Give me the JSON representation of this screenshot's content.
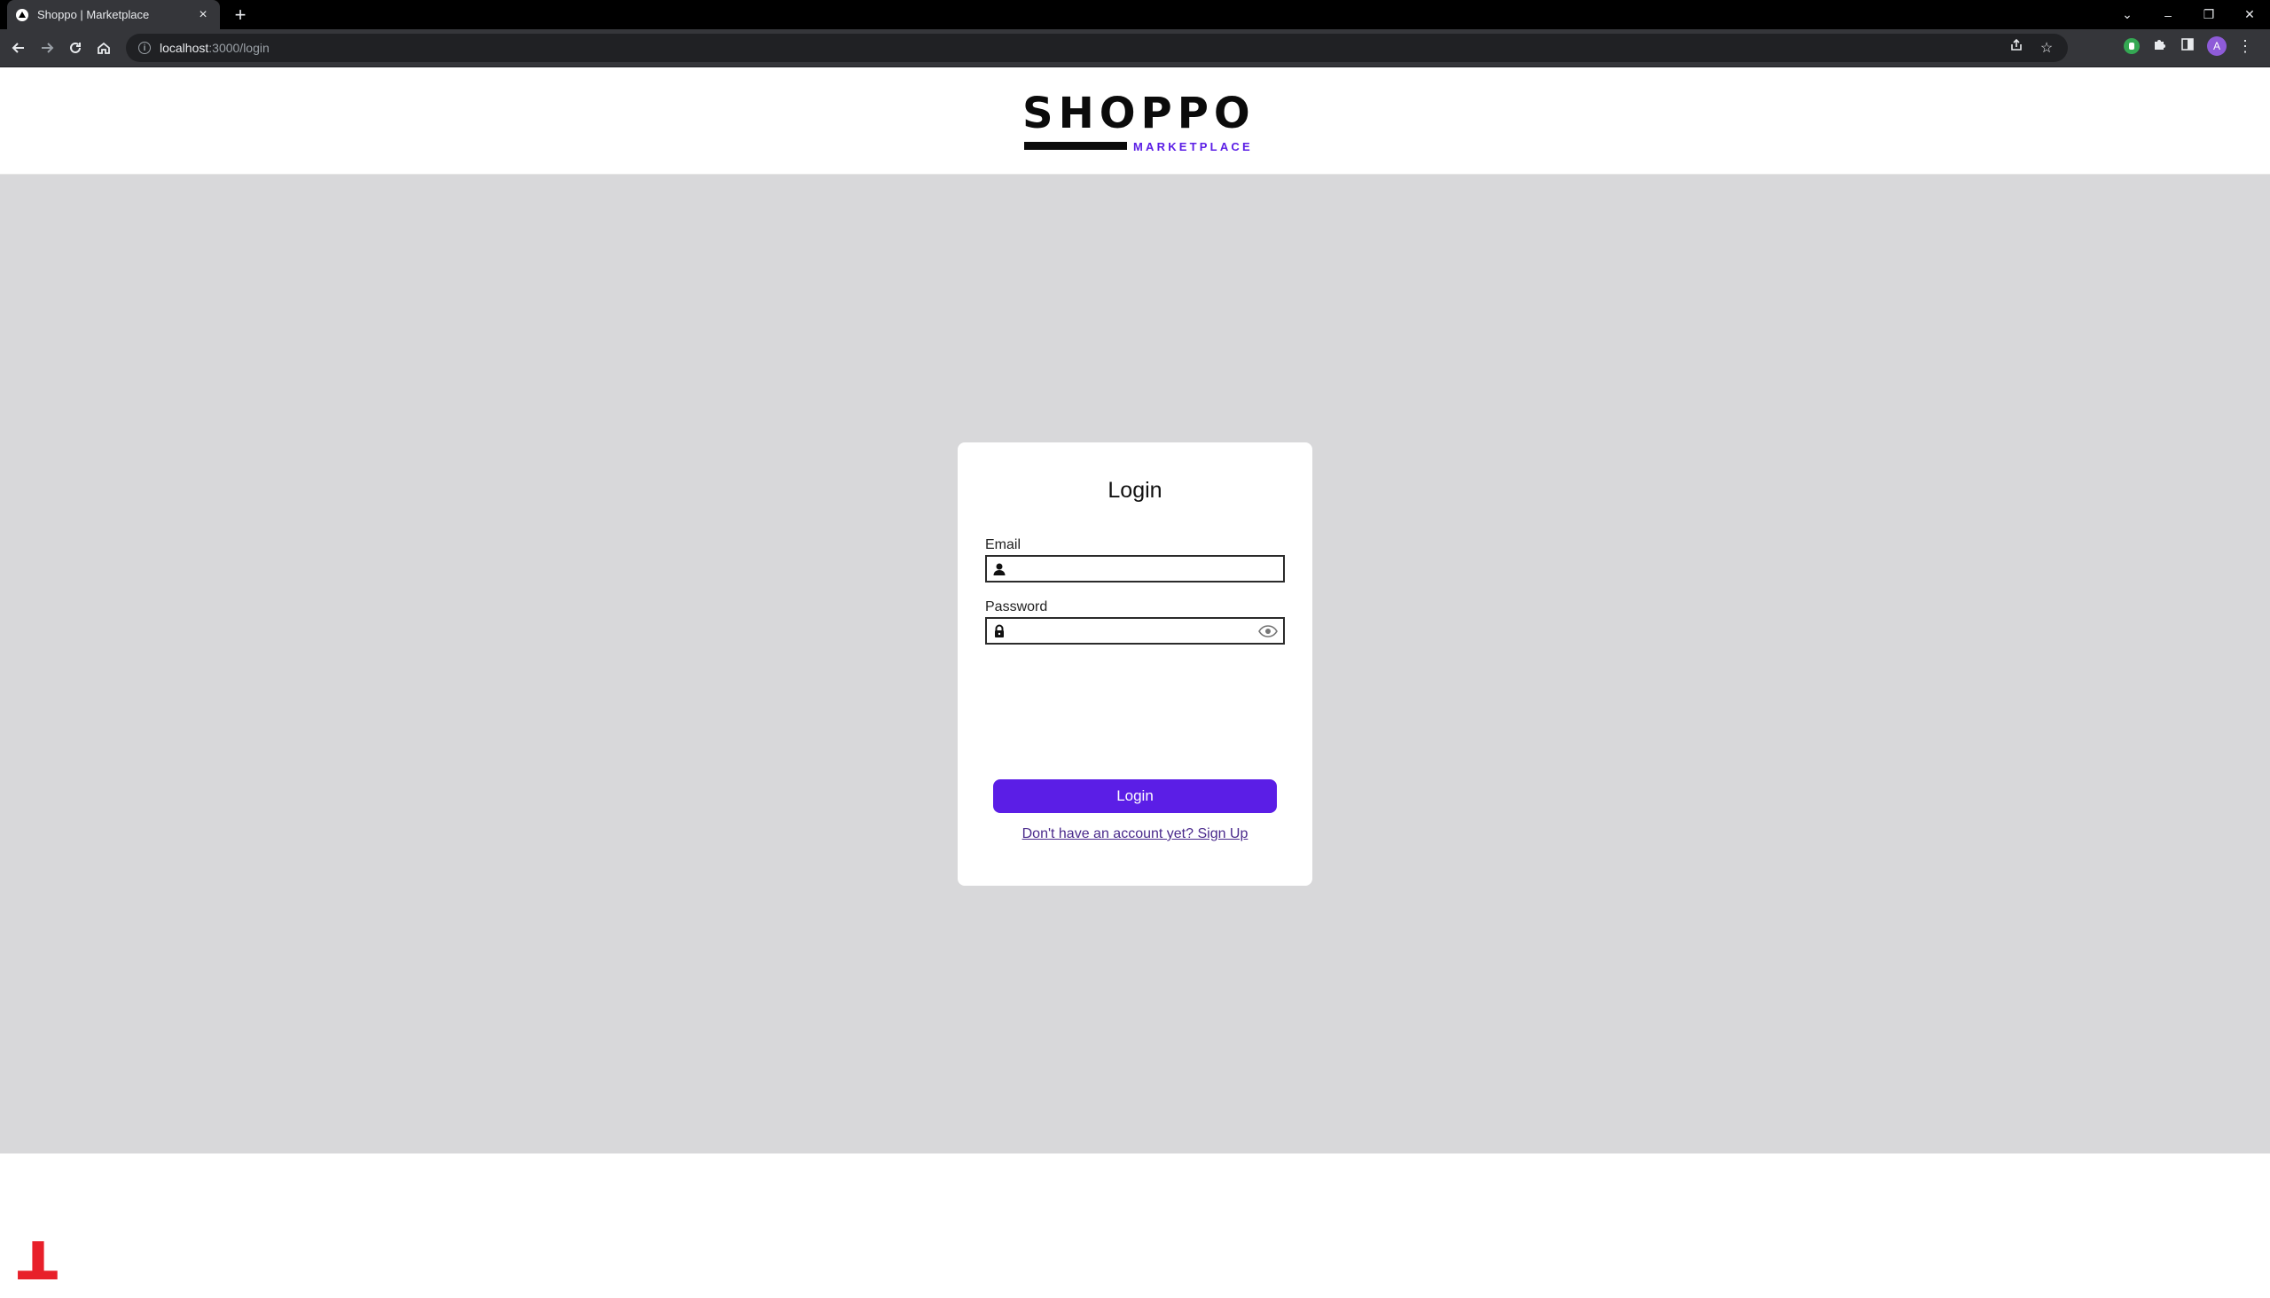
{
  "browser": {
    "tab_title": "Shoppo | Marketplace",
    "tab_close": "×",
    "new_tab": "+",
    "url_host": "localhost",
    "url_path": ":3000/login",
    "window_controls": {
      "minimize": "–",
      "restore": "❐",
      "close": "✕",
      "tab_search": "⌄"
    },
    "avatar_initial": "A"
  },
  "header": {
    "logo_word": "SHOPPO",
    "logo_tag": "MARKETPLACE"
  },
  "login": {
    "title": "Login",
    "email_label": "Email",
    "email_value": "",
    "password_label": "Password",
    "password_value": "",
    "submit_label": "Login",
    "signup_link": "Don't have an account yet? Sign Up"
  },
  "overlay": {
    "step_marker": "1"
  },
  "colors": {
    "accent": "#5b1ee6",
    "page_bg": "#d8d8da",
    "marker": "#e8202a"
  },
  "icons": [
    "back-icon",
    "forward-icon",
    "reload-icon",
    "home-icon",
    "info-icon",
    "share-icon",
    "star-icon",
    "extension-icon",
    "puzzle-icon",
    "sidepanel-icon",
    "user-icon",
    "lock-icon",
    "eye-icon"
  ]
}
